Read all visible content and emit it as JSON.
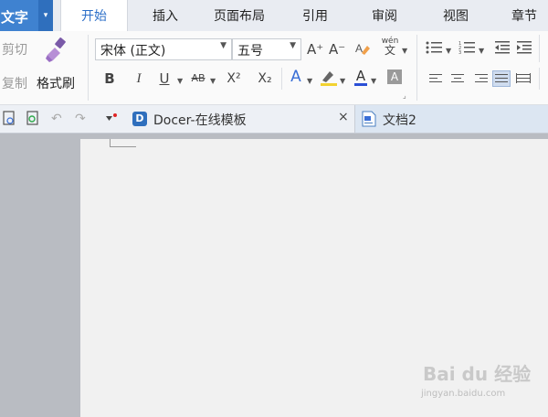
{
  "app": {
    "name": "文字",
    "dropdown_glyph": "▾"
  },
  "menu_tabs": [
    {
      "label": "开始",
      "active": true
    },
    {
      "label": "插入",
      "active": false
    },
    {
      "label": "页面布局",
      "active": false
    },
    {
      "label": "引用",
      "active": false
    },
    {
      "label": "审阅",
      "active": false
    },
    {
      "label": "视图",
      "active": false
    },
    {
      "label": "章节",
      "active": false
    }
  ],
  "clipboard": {
    "cut_label": "剪切",
    "copy_label": "复制",
    "format_painter_label": "格式刷"
  },
  "font": {
    "name_value": "宋体 (正文)",
    "size_value": "五号",
    "grow_glyph": "A⁺",
    "shrink_glyph": "A⁻",
    "bold": "B",
    "italic": "I",
    "underline": "U",
    "strikethrough": "AB",
    "superscript": "X²",
    "subscript": "X₂",
    "text_effect": "A",
    "font_color": "A",
    "char_shading": "A",
    "phonetic_glyph": "wén\n文"
  },
  "colors": {
    "accent": "#3f82d0",
    "active_tab_text": "#2c6fc8",
    "font_color_bar": "#2a4fd6",
    "highlight_bar": "#f2d230",
    "doc_tab_active_bg": "#dce6f2"
  },
  "doc_tabs": [
    {
      "title": "Docer-在线模板",
      "icon": "docer-icon",
      "close": "×"
    },
    {
      "title": "文档2",
      "icon": "document-icon",
      "active": true
    }
  ],
  "watermark": {
    "logo": "Bai du 经验",
    "url": "jingyan.baidu.com"
  }
}
